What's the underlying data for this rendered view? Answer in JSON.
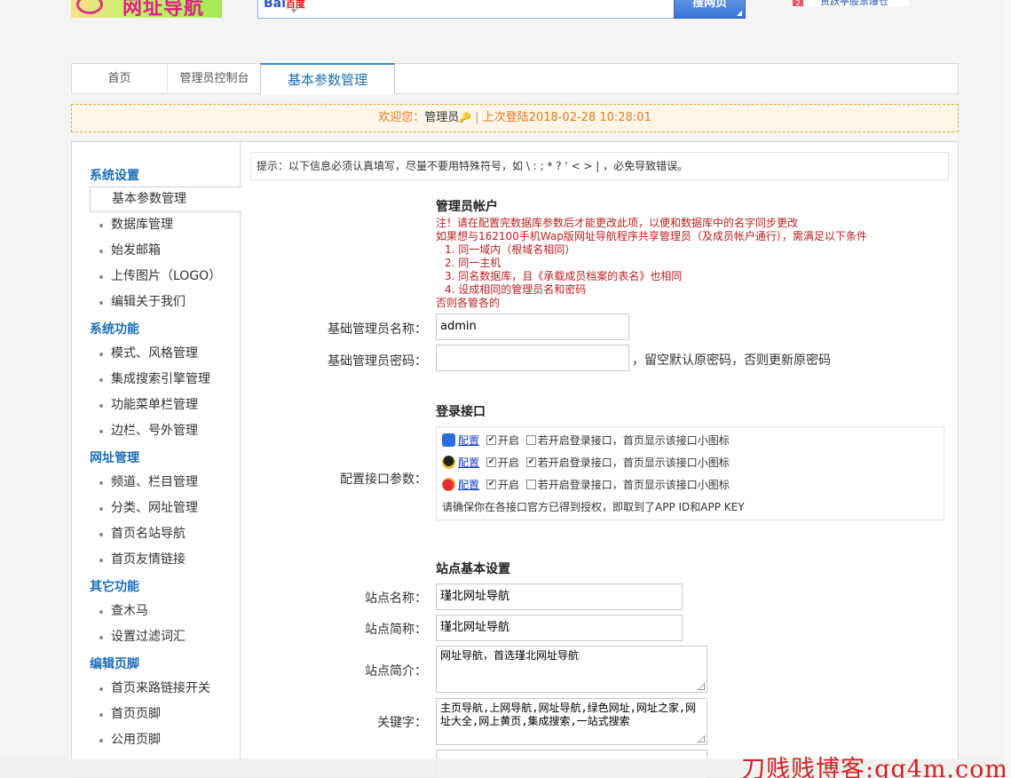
{
  "header": {
    "logo_text": "网址导航",
    "search_engine": "Bai",
    "search_engine_cn": "百度",
    "search_button": "搜网页",
    "hot_number": "2",
    "hot_text": "贾跃亭股票爆仓"
  },
  "tabs": [
    {
      "label": "首页"
    },
    {
      "label": "管理员控制台"
    },
    {
      "label": "基本参数管理"
    }
  ],
  "welcome": {
    "prefix": "欢迎您：",
    "user": "管理员",
    "key_icon": "key-icon",
    "separator": "|",
    "last_login": "上次登陆2018-02-28 10:28:01"
  },
  "sidebar": {
    "sections": [
      {
        "title": "系统设置",
        "items": [
          "基本参数管理",
          "数据库管理",
          "始发邮箱",
          "上传图片（LOGO）",
          "编辑关于我们"
        ]
      },
      {
        "title": "系统功能",
        "items": [
          "模式、风格管理",
          "集成搜索引擎管理",
          "功能菜单栏管理",
          "边栏、号外管理"
        ]
      },
      {
        "title": "网址管理",
        "items": [
          "频道、栏目管理",
          "分类、网址管理",
          "首页名站导航",
          "首页友情链接"
        ]
      },
      {
        "title": "其它功能",
        "items": [
          "查木马",
          "设置过滤词汇"
        ]
      },
      {
        "title": "编辑页脚",
        "items": [
          "首页来路链接开关",
          "首页页脚",
          "公用页脚"
        ]
      }
    ]
  },
  "content": {
    "tip": "提示：以下信息必须认真填写，尽量不要用特殊符号，如 \\ : ; * ? ' < > | ，必免导致错误。",
    "admin_section": {
      "title": "管理员帐户",
      "note_lines": [
        "注！请在配置完数据库参数后才能更改此项，以便和数据库中的名字同步更改",
        "如果想与162100手机Wap版网址导航程序共享管理员（及成员帐户通行），需满足以下条件",
        "1. 同一域内（根域名相同）",
        "2. 同一主机",
        "3. 同名数据库，且《承载成员档案的表名》也相同",
        "4. 设成相同的管理员名和密码",
        "否则各管各的"
      ],
      "name_label": "基础管理员名称：",
      "name_value": "admin",
      "password_label": "基础管理员密码：",
      "password_value": "",
      "password_hint": "，留空默认原密码，否则更新原密码"
    },
    "login_section": {
      "title": "登录接口",
      "label": "配置接口参数：",
      "rows": [
        {
          "icon": "baidu-paw-icon",
          "config": "配置",
          "enabled": true,
          "enable_label": "开启",
          "show_icon": false,
          "show_label": "若开启登录接口，首页显示该接口小图标"
        },
        {
          "icon": "qq-penguin-icon",
          "config": "配置",
          "enabled": true,
          "enable_label": "开启",
          "show_icon": true,
          "show_label": "若开启登录接口，首页显示该接口小图标"
        },
        {
          "icon": "weibo-icon",
          "config": "配置",
          "enabled": true,
          "enable_label": "开启",
          "show_icon": false,
          "show_label": "若开启登录接口，首页显示该接口小图标"
        }
      ],
      "notice": "请确保你在各接口官方已得到授权，即取到了APP ID和APP KEY"
    },
    "site_section": {
      "title": "站点基本设置",
      "site_name_label": "站点名称：",
      "site_name_value": "瑾北网址导航",
      "site_short_label": "站点简称：",
      "site_short_value": "瑾北网址导航",
      "site_desc_label": "站点简介：",
      "site_desc_value": "网址导航，首选瑾北网址导航",
      "keywords_label": "关键字：",
      "keywords_value": "主页导航,上网导航,网址导航,绿色网址,网址之家,网址大全,网上黄页,集成搜索,一站式搜索"
    }
  },
  "watermark": "刀贱贱博客:qq4m.com",
  "colors": {
    "accent": "#1d6fb8",
    "warning": "#e87820",
    "note": "#b22222",
    "watermark": "#d42020"
  }
}
